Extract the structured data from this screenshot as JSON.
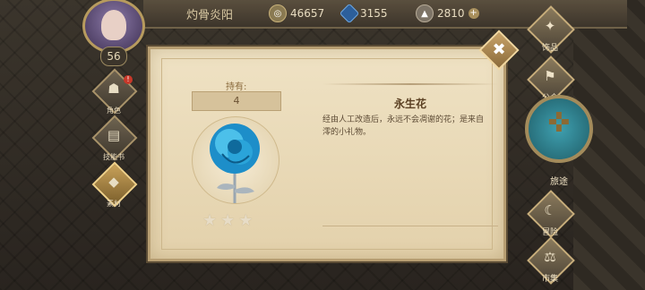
{
  "header": {
    "player_name": "灼骨炎阳",
    "gold": "46657",
    "gems": "3155",
    "stone": "2810",
    "plus": "+"
  },
  "player": {
    "level": "56"
  },
  "sidebar": {
    "items": [
      {
        "label": "角色",
        "badge": "!"
      },
      {
        "label": "技能书"
      },
      {
        "label": "素材"
      }
    ]
  },
  "item": {
    "own_label": "持有:",
    "own_count": "4",
    "name": "永生花",
    "description": "经由人工改造后，永远不会凋谢的花；是来自澪的小礼物。",
    "stars": 3
  },
  "close": {
    "label": "✖"
  },
  "right_nav": [
    {
      "label": "饰品"
    },
    {
      "label": "公会"
    },
    {
      "label": "旅途"
    },
    {
      "label": "冒险"
    },
    {
      "label": "市集"
    }
  ]
}
